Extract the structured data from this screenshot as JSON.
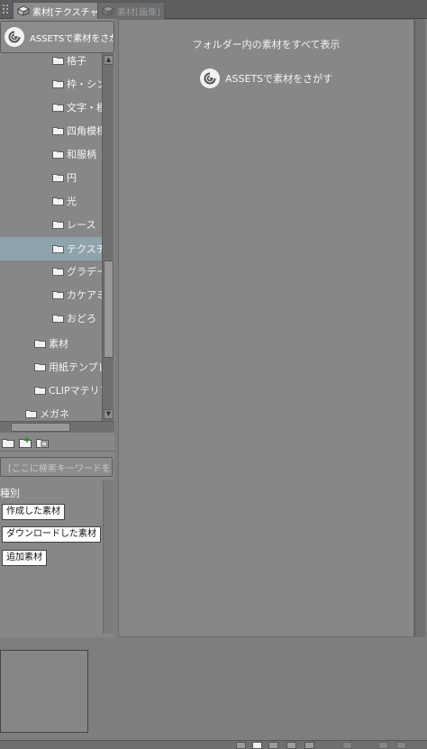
{
  "tabs": [
    {
      "label": "素材[テクスチャ]",
      "active": true
    },
    {
      "label": "素材[画像]",
      "active": false
    }
  ],
  "assets_button": {
    "label": "ASSETSで素材をさがす"
  },
  "tree": {
    "items": [
      {
        "label": "格子",
        "indent": 2
      },
      {
        "label": "枠・シンボル",
        "indent": 2
      },
      {
        "label": "文字・模様",
        "indent": 2
      },
      {
        "label": "四角模様",
        "indent": 2
      },
      {
        "label": "和服柄",
        "indent": 2
      },
      {
        "label": "円",
        "indent": 2
      },
      {
        "label": "光",
        "indent": 2
      },
      {
        "label": "レース",
        "indent": 2
      },
      {
        "label": "テクスチャ",
        "indent": 2,
        "selected": true
      },
      {
        "label": "グラデーション",
        "indent": 2
      },
      {
        "label": "カケアミ",
        "indent": 2
      },
      {
        "label": "おどろ",
        "indent": 2
      },
      {
        "label": "素材",
        "indent": 1
      },
      {
        "label": "用紙テンプレート",
        "indent": 1
      },
      {
        "label": "CLIPマテリアル",
        "indent": 1
      },
      {
        "label": "メガネ",
        "indent": 0
      }
    ]
  },
  "search": {
    "placeholder": "[ここに検索キーワードを入力]"
  },
  "kind": {
    "label": "種別",
    "chips": [
      "作成した素材",
      "ダウンロードした素材",
      "追加素材"
    ]
  },
  "main": {
    "show_all": "フォルダー内の素材をすべて表示",
    "assets_link": "ASSETSで素材をさがす"
  },
  "colors": {
    "selected_row": "#8fa3ad",
    "panel": "#858789"
  }
}
